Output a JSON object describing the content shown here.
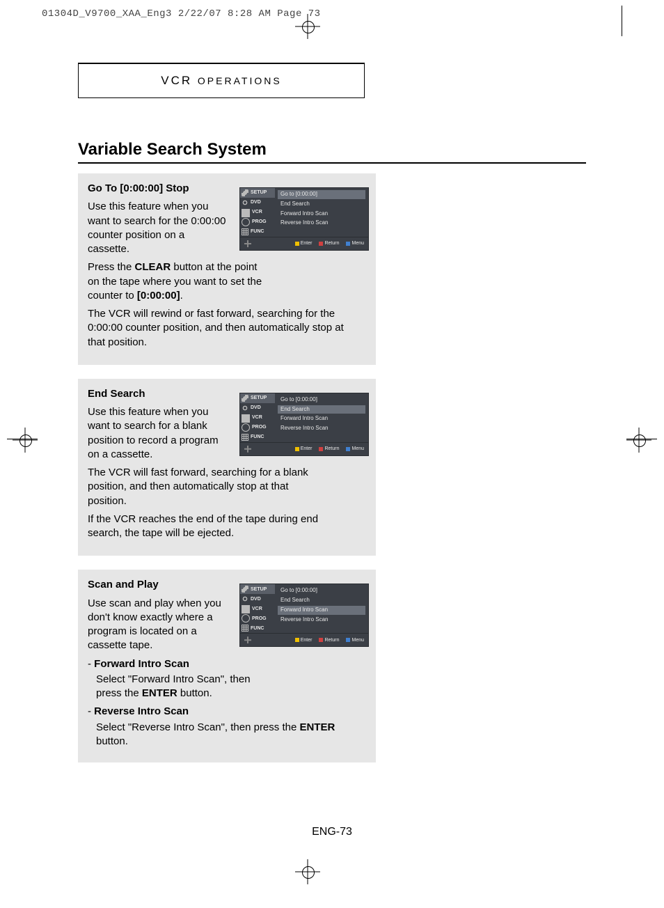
{
  "print_header": "01304D_V9700_XAA_Eng3  2/22/07  8:28 AM  Page 73",
  "chapter": {
    "prefix": "VCR ",
    "rest": "OPERATIONS"
  },
  "title": "Variable Search System",
  "footer": "ENG-73",
  "sections": [
    {
      "heading": "Go To [0:00:00] Stop",
      "p1": "Use this feature when you want to search for the 0:00:00 counter position on a cassette.",
      "p2a": "Press the ",
      "p2b": "CLEAR",
      "p2c": " button at the point on the tape where you want to set the counter to ",
      "p2d": "[0:00:00]",
      "p2e": ".",
      "p3": "The VCR will rewind or fast forward, searching for the 0:00:00 counter position, and then automatically stop at that position.",
      "osd_highlight": 0
    },
    {
      "heading": "End Search",
      "p1": "Use this feature when you want to search for a blank position to record a program on a cassette.",
      "p2": "The VCR will fast forward, searching for a blank position, and then automatically stop at that position.",
      "p3": "If the VCR reaches the end of the tape during end search, the tape will be ejected.",
      "osd_highlight": 1
    },
    {
      "heading": "Scan and Play",
      "p1": "Use scan and play when you don't know exactly where a program is located on a cassette tape.",
      "b1_label": "Forward Intro Scan",
      "b1_text_a": "Select \"Forward Intro Scan\", then press the ",
      "b1_text_b": "ENTER",
      "b1_text_c": " button.",
      "b2_label": "Reverse Intro Scan",
      "b2_text_a": "Select \"Reverse Intro Scan\", then press the ",
      "b2_text_b": "ENTER",
      "b2_text_c": " button.",
      "osd_highlight": 2
    }
  ],
  "osd": {
    "side": [
      "SETUP",
      "DVD",
      "VCR",
      "PROG",
      "FUNC"
    ],
    "rows": [
      "Go to [0:00:00]",
      "End Search",
      "Forward Intro Scan",
      "Reverse Intro Scan"
    ],
    "foot": {
      "enter": "Enter",
      "return": "Return",
      "menu": "Menu"
    }
  }
}
